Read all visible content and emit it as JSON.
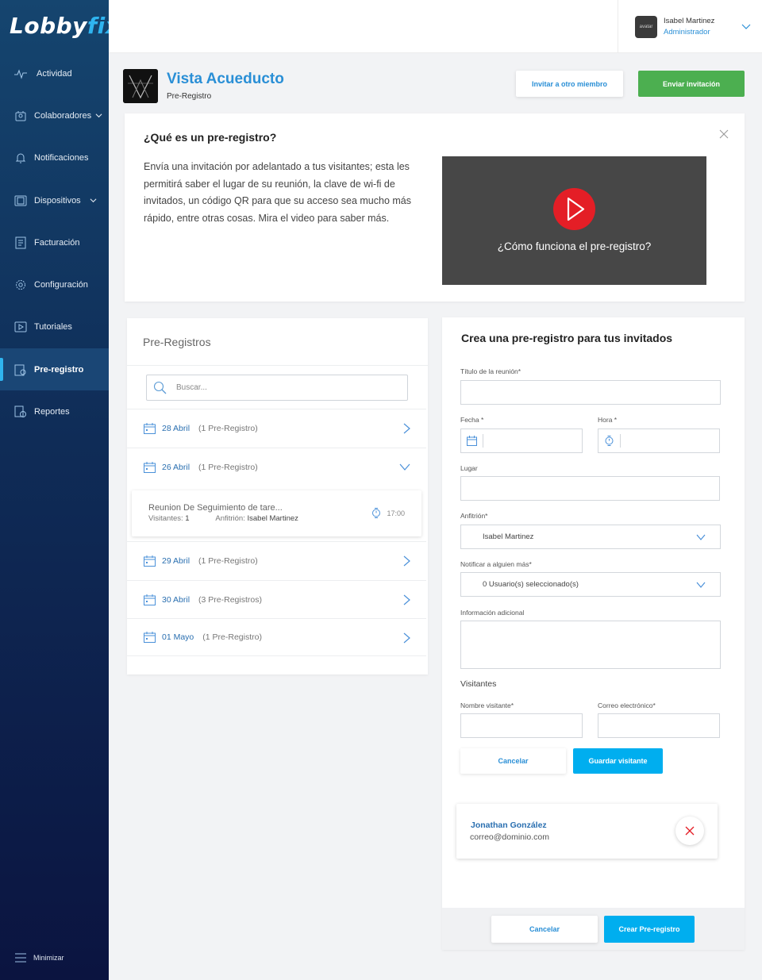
{
  "app": {
    "logo_main": "Lobby",
    "logo_accent": "fix"
  },
  "sidebar": {
    "items": [
      {
        "label": "Actividad",
        "icon": "activity-icon"
      },
      {
        "label": "Colaboradores",
        "icon": "collaborators-icon",
        "has_submenu": true
      },
      {
        "label": "Notificaciones",
        "icon": "bell-icon"
      },
      {
        "label": "Dispositivos",
        "icon": "devices-icon",
        "has_submenu": true
      },
      {
        "label": "Facturación",
        "icon": "billing-icon"
      },
      {
        "label": "Configuración",
        "icon": "gear-icon"
      },
      {
        "label": "Tutoriales",
        "icon": "play-icon"
      },
      {
        "label": "Pre-registro",
        "icon": "preregister-icon",
        "active": true
      },
      {
        "label": "Reportes",
        "icon": "reports-icon"
      }
    ],
    "minimize_label": "Minimizar"
  },
  "user": {
    "avatar_text": "avatar",
    "name": "Isabel Martinez",
    "role": "Administrador"
  },
  "header": {
    "title": "Vista Acueducto",
    "subtitle": "Pre-Registro",
    "invite_button": "Invitar a otro miembro",
    "send_button": "Enviar invitación"
  },
  "info": {
    "title": "¿Qué es un pre-registro?",
    "text": "Envía una invitación por adelantado a tus visitantes; esta les permitirá saber el lugar de su reunión, la clave de wi-fi de invitados, un código QR para que su acceso sea mucho más rápido, entre otras cosas. Mira el video para saber más.",
    "video_caption": "¿Cómo funciona el pre-registro?"
  },
  "list": {
    "title": "Pre-Registros",
    "search_placeholder": "Buscar...",
    "rows": [
      {
        "date": "28 Abril",
        "count": "(1 Pre-Registro)",
        "expanded": false
      },
      {
        "date": "26 Abril",
        "count": "(1 Pre-Registro)",
        "expanded": true
      },
      {
        "date": "29 Abril",
        "count": "(1 Pre-Registro)",
        "expanded": false
      },
      {
        "date": "30 Abril",
        "count": "(3 Pre-Registros)",
        "expanded": false
      },
      {
        "date": "01 Mayo",
        "count": "(1 Pre-Registro)",
        "expanded": false
      }
    ],
    "meeting": {
      "title": "Reunion De Seguimiento de tare...",
      "visitors_label": "Visitantes:",
      "visitors_value": "1",
      "host_label": "Anfitrión:",
      "host_value": "Isabel Martinez",
      "time": "17:00"
    }
  },
  "form": {
    "title": "Crea una pre-registro para tus invitados",
    "meeting_title_label": "Título de la reunión*",
    "meeting_title_value": "",
    "date_label": "Fecha *",
    "date_value": "",
    "time_label": "Hora *",
    "time_value": "",
    "place_label": "Lugar",
    "place_value": "",
    "host_label": "Anfitrión*",
    "host_value": "Isabel Martinez",
    "notify_label": "Notificar a alguien más*",
    "notify_value": "0 Usuario(s) seleccionado(s)",
    "extra_label": "Información adicional",
    "extra_value": "",
    "visitors_section": "Visitantes",
    "visitor_name_label": "Nombre visitante*",
    "visitor_name_value": "",
    "visitor_email_label": "Correo electrónico*",
    "visitor_email_value": "",
    "cancel_visitor": "Cancelar",
    "save_visitor": "Guardar visitante",
    "visitor": {
      "name": "Jonathan González",
      "email": "correo@dominio.com"
    },
    "cancel": "Cancelar",
    "create": "Crear Pre-registro"
  },
  "colors": {
    "accent": "#2a8fd6",
    "green": "#4caf50",
    "cyan": "#00aeef",
    "danger": "#e41e26"
  }
}
